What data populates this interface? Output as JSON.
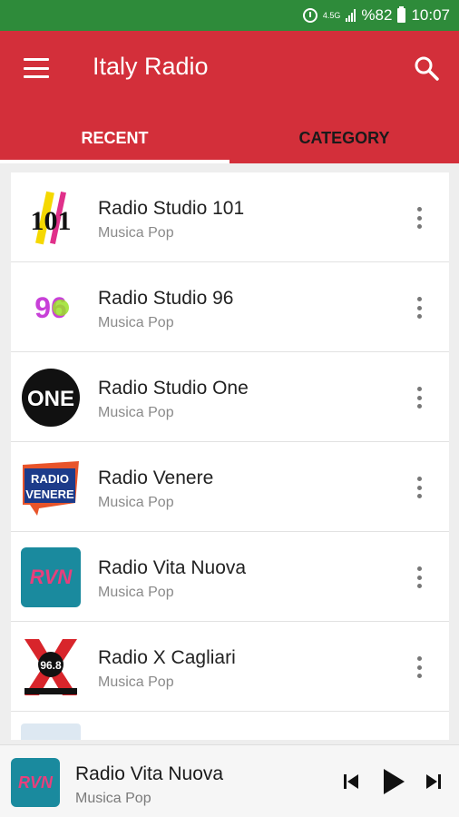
{
  "status_bar": {
    "network": "4.5G",
    "battery": "%82",
    "time": "10:07"
  },
  "app_bar": {
    "title": "Italy Radio",
    "tabs": [
      {
        "label": "RECENT",
        "active": true
      },
      {
        "label": "CATEGORY",
        "active": false
      }
    ]
  },
  "colors": {
    "status_bar": "#2e8b3a",
    "app_bar": "#d32f3a"
  },
  "stations": [
    {
      "name": "Radio Studio 101",
      "category": "Musica Pop",
      "logo": "studio-101-logo",
      "logo_text": "101"
    },
    {
      "name": "Radio Studio 96",
      "category": "Musica Pop",
      "logo": "studio-96-logo",
      "logo_text": "96"
    },
    {
      "name": "Radio Studio One",
      "category": "Musica Pop",
      "logo": "studio-one-logo",
      "logo_text": "ONE"
    },
    {
      "name": "Radio Venere",
      "category": "Musica Pop",
      "logo": "venere-logo",
      "logo_text": "RADIO VENERE"
    },
    {
      "name": "Radio Vita Nuova",
      "category": "Musica Pop",
      "logo": "vita-nuova-logo",
      "logo_text": "RVN"
    },
    {
      "name": "Radio X Cagliari",
      "category": "Musica Pop",
      "logo": "x-cagliari-logo",
      "logo_text": "96.8"
    }
  ],
  "player": {
    "title": "Radio Vita Nuova",
    "subtitle": "Musica Pop",
    "logo_text": "RVN"
  }
}
